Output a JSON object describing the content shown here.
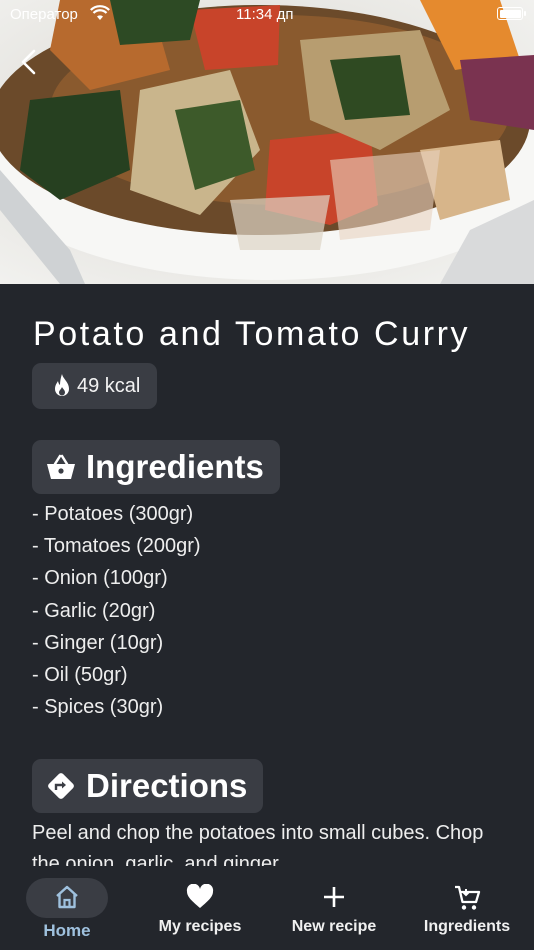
{
  "status_bar": {
    "carrier": "Оператор",
    "time": "11:34 дп"
  },
  "recipe": {
    "title": "Potato and Tomato Curry",
    "calories": "49 kcal"
  },
  "ingredients": {
    "heading": "Ingredients",
    "items": [
      "- Potatoes (300gr)",
      "- Tomatoes (200gr)",
      "- Onion (100gr)",
      "- Garlic (20gr)",
      "- Ginger (10gr)",
      "- Oil (50gr)",
      "- Spices (30gr)"
    ]
  },
  "directions": {
    "heading": "Directions",
    "text": "Peel and chop the potatoes into small cubes. Chop the onion, garlic, and ginger."
  },
  "nav": {
    "items": [
      {
        "label": "Home",
        "icon": "home-icon",
        "active": true
      },
      {
        "label": "My recipes",
        "icon": "heart-icon",
        "active": false
      },
      {
        "label": "New recipe",
        "icon": "plus-icon",
        "active": false
      },
      {
        "label": "Ingredients",
        "icon": "cart-icon",
        "active": false
      }
    ]
  },
  "colors": {
    "background": "#23262c",
    "chip": "#3a3d44",
    "active_nav": "#9fc1de"
  }
}
